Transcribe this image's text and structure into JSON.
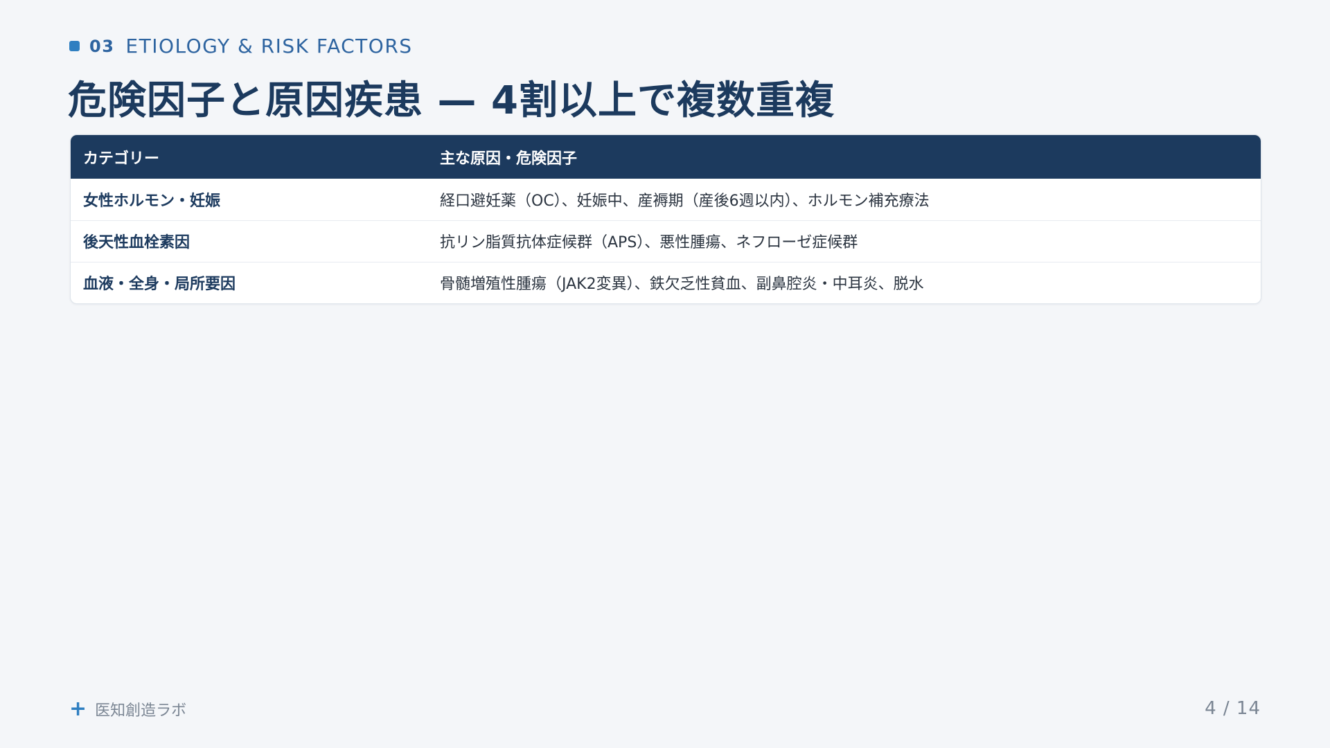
{
  "header": {
    "section_number": "03",
    "section_label": "ETIOLOGY & RISK FACTORS",
    "title": "危険因子と原因疾患 — 4割以上で複数重複"
  },
  "table": {
    "columns": [
      "カテゴリー",
      "主な原因・危険因子"
    ],
    "rows": [
      {
        "category": "女性ホルモン・妊娠",
        "causes": "経口避妊薬（OC）、妊娠中、産褥期（産後6週以内）、ホルモン補充療法"
      },
      {
        "category": "後天性血栓素因",
        "causes": "抗リン脂質抗体症候群（APS）、悪性腫瘍、ネフローゼ症候群"
      },
      {
        "category": "血液・全身・局所要因",
        "causes": "骨髄増殖性腫瘍（JAK2変異）、鉄欠乏性貧血、副鼻腔炎・中耳炎、脱水"
      }
    ]
  },
  "footer": {
    "icon": "plus-icon",
    "brand": "医知創造ラボ",
    "page": "4 / 14"
  },
  "colors": {
    "background": "#f4f6f9",
    "primary": "#1c3a5e",
    "accent": "#2f7fc1"
  }
}
